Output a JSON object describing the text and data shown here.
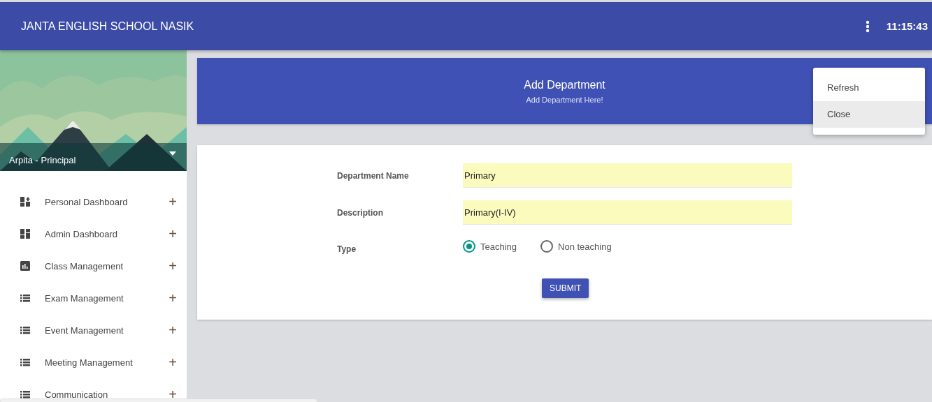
{
  "app_bar": {
    "title": "JANTA ENGLISH SCHOOL NASIK",
    "clock": "11:15:43"
  },
  "profile": {
    "user": "Arpita - Principal"
  },
  "sidebar": {
    "items": [
      {
        "label": "Personal Dashboard",
        "kind": "dashboard-plus",
        "expand": "+"
      },
      {
        "label": "Admin Dashboard",
        "kind": "dashboard",
        "expand": "+"
      },
      {
        "label": "Class Management",
        "kind": "chart",
        "expand": "+"
      },
      {
        "label": "Exam Management",
        "kind": "list",
        "expand": "+"
      },
      {
        "label": "Event Management",
        "kind": "list",
        "expand": "+"
      },
      {
        "label": "Meeting Management",
        "kind": "list",
        "expand": "+"
      },
      {
        "label": "Communication",
        "kind": "list",
        "expand": "+"
      }
    ]
  },
  "header_card": {
    "title": "Add Department",
    "subtitle": "Add Department Here!"
  },
  "form": {
    "fields": [
      {
        "label": "Department Name",
        "value": "Primary"
      },
      {
        "label": "Description",
        "value": "Primary(I-IV)"
      }
    ],
    "type": {
      "label": "Type",
      "options": [
        {
          "label": "Teaching",
          "selected": true
        },
        {
          "label": "Non teaching",
          "selected": false
        }
      ]
    },
    "submit": "SUBMIT"
  },
  "menu": {
    "items": [
      {
        "label": "Refresh",
        "selected": false
      },
      {
        "label": "Close",
        "selected": true
      }
    ]
  }
}
